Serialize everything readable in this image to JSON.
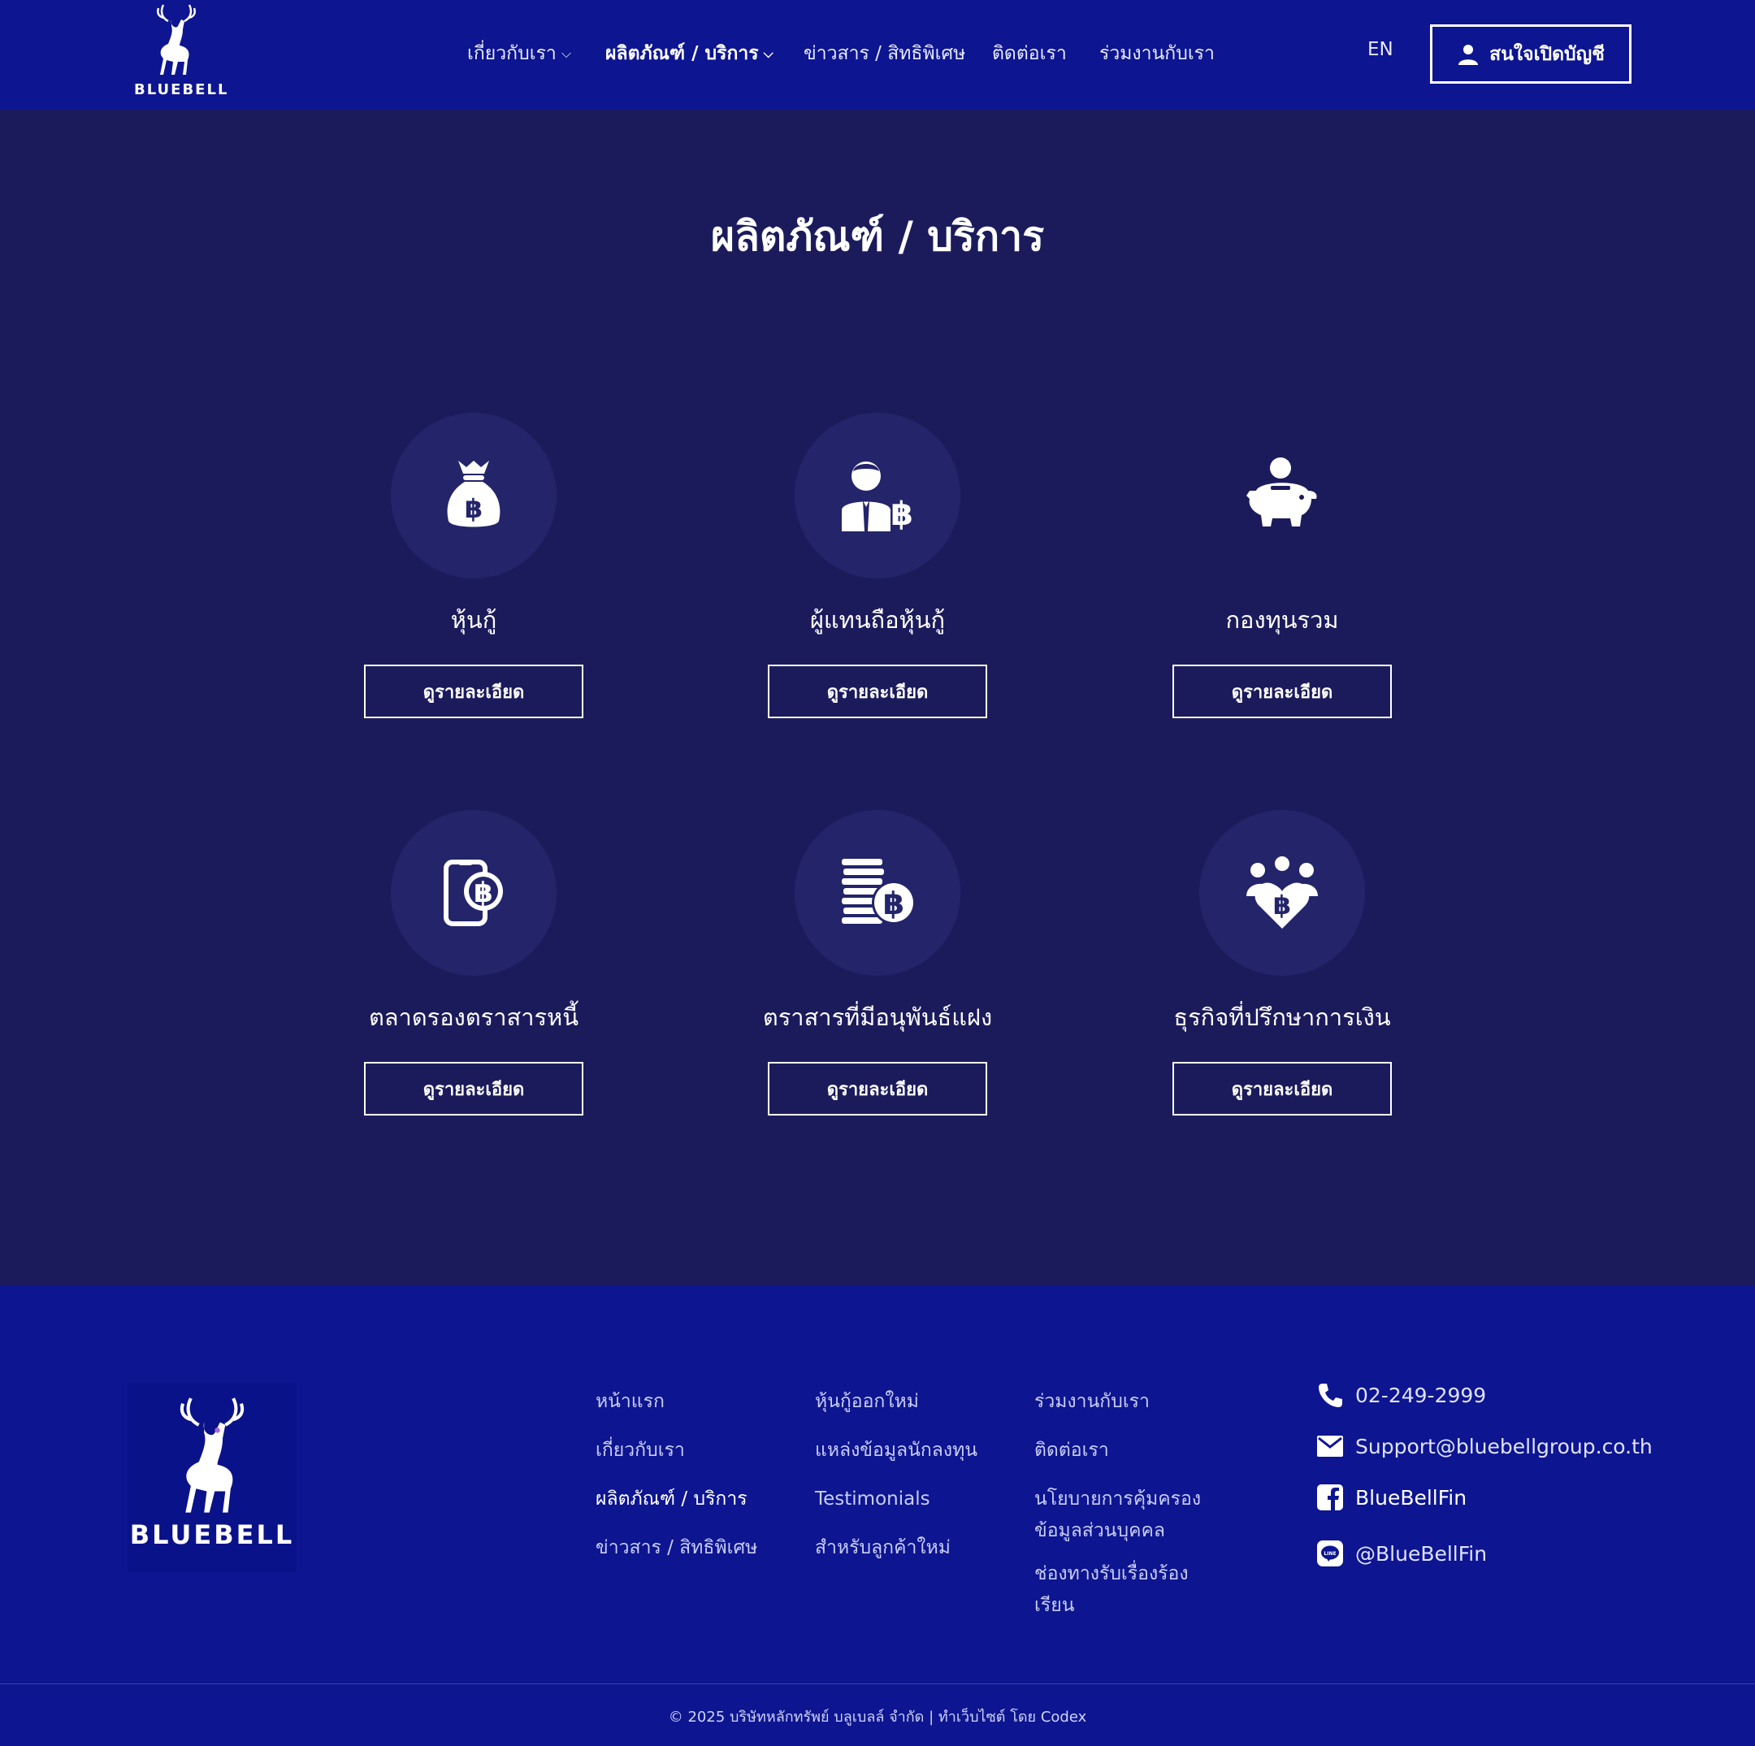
{
  "brand": {
    "name": "BLUEBELL"
  },
  "nav": {
    "items": [
      {
        "label": "เกี่ยวกับเรา",
        "dropdown": true
      },
      {
        "label": "ผลิตภัณฑ์ / บริการ",
        "dropdown": true,
        "active": true
      },
      {
        "label": "ข่าวสาร / สิทธิพิเศษ"
      },
      {
        "label": "ติดต่อเรา"
      },
      {
        "label": "ร่วมงานกับเรา"
      }
    ],
    "lang": "EN",
    "open_account": "สนใจเปิดบัญชี"
  },
  "main": {
    "title": "ผลิตภัณฑ์ / บริการ",
    "detail_label": "ดูรายละเอียด",
    "cards": [
      {
        "label": "หุ้นกู้",
        "icon": "money-bag-icon"
      },
      {
        "label": "ผู้แทนถือหุ้นกู้",
        "icon": "agent-baht-icon"
      },
      {
        "label": "กองทุนรวม",
        "icon": "piggy-bank-icon"
      },
      {
        "label": "ตลาดรองตราสารหนี้",
        "icon": "mobile-baht-icon"
      },
      {
        "label": "ตราสารที่มีอนุพันธ์แฝง",
        "icon": "coins-baht-icon"
      },
      {
        "label": "ธุรกิจที่ปรึกษาการเงิน",
        "icon": "group-heart-baht-icon"
      }
    ]
  },
  "footer": {
    "col1": [
      "หน้าแรก",
      "เกี่ยวกับเรา",
      "ผลิตภัณฑ์ / บริการ",
      "ข่าวสาร / สิทธิพิเศษ"
    ],
    "col2": [
      "หุ้นกู้ออกใหม่",
      "แหล่งข้อมูลนักลงทุน",
      "Testimonials",
      "สำหรับลูกค้าใหม่"
    ],
    "col3": [
      "ร่วมงานกับเรา",
      "ติดต่อเรา",
      "นโยบายการคุ้มครอง",
      "ข้อมูลส่วนบุคคล",
      "ช่องทางรับเรื่องร้อง",
      "เรียน"
    ],
    "phone": "02-249-2999",
    "email": "Support@bluebellgroup.co.th",
    "facebook": "BlueBellFin",
    "line": "@BlueBellFin",
    "copyright": "© 2025 บริษัทหลักทรัพย์ บลูเบลล์ จำกัด  |  ทำเว็บไซต์ โดย Codex"
  },
  "colors": {
    "header_bg": "#0d1590",
    "page_bg": "#1b1b5c",
    "circle_bg": "#23246a"
  }
}
